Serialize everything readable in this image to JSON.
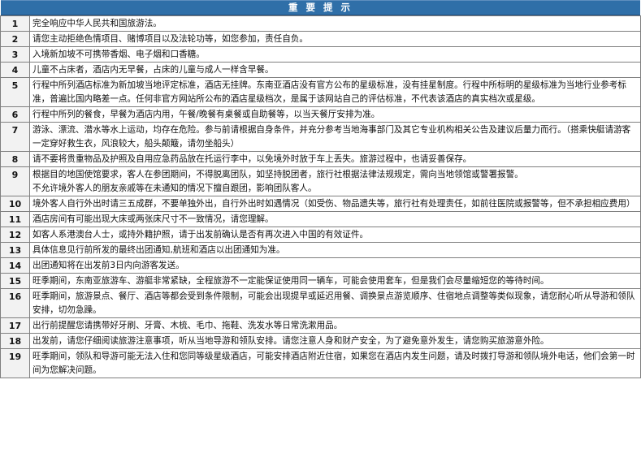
{
  "title": "重 要 提 示",
  "rows": [
    {
      "num": "1",
      "text": "完全响应中华人民共和国旅游法。"
    },
    {
      "num": "2",
      "text": "请您主动拒绝色情项目、赌博项目以及法轮功等，如您参加，责任自负。"
    },
    {
      "num": "3",
      "text": "入境新加坡不可携带香烟、电子烟和口香糖。"
    },
    {
      "num": "4",
      "text": "儿童不占床者，酒店内无早餐，占床的儿童与成人一样含早餐。"
    },
    {
      "num": "5",
      "text": "行程中所列酒店标准为新加坡当地评定标准，酒店无挂牌。东南亚酒店没有官方公布的星级标准，没有挂星制度。行程中所标明的星级标准为当地行业参考标准，普遍比国内略差一点。任何非官方网站所公布的酒店星级档次，是属于该网站自己的评估标准，不代表该酒店的真实档次或星级。"
    },
    {
      "num": "6",
      "text": "行程中所列的餐食，早餐为酒店内用，午餐/晚餐有桌餐或自助餐等，以当天餐厅安排为准。"
    },
    {
      "num": "7",
      "text": "游泳、漂流、潜水等水上运动，均存在危险。参与前请根据自身条件，并充分参考当地海事部门及其它专业机构相关公告及建议后量力而行。（搭乘快艇请游客一定穿好救生衣，风浪较大，船头颠簸，请勿坐船头）"
    },
    {
      "num": "8",
      "text": "请不要将贵重物品及护照及自用应急药品放在托运行李中，以免境外时放于车上丢失。旅游过程中，也请妥善保存。"
    },
    {
      "num": "9",
      "text": "根据目的地国使馆要求，客人在参团期间，不得脱离团队，如坚持脱团者，旅行社根据法律法规规定，需向当地领馆或警署报警。\n不允许境外客人的朋友亲戚等在未通知的情况下擅自跟团，影响团队客人。"
    },
    {
      "num": "10",
      "text": "境外客人自行外出时请三五成群，不要单独外出，自行外出时如遇情况（如受伤、物品遗失等，旅行社有处理责任，如前往医院或报警等，但不承担相应费用）"
    },
    {
      "num": "11",
      "text": "酒店房间有可能出现大床或两张床尺寸不一致情况，请您理解。"
    },
    {
      "num": "12",
      "text": "如客人系港澳台人士，或持外籍护照，请于出发前确认是否有再次进入中国的有效证件。"
    },
    {
      "num": "13",
      "text": "具体信息见行前所发的最终出团通知,航班和酒店以出团通知为准。"
    },
    {
      "num": "14",
      "text": "出团通知将在出发前3日内向游客发送。"
    },
    {
      "num": "15",
      "text": "旺季期间，东南亚旅游车、游艇非常紧缺，全程旅游不一定能保证使用同一辆车，可能会使用套车，但是我们会尽量缩短您的等待时间。"
    },
    {
      "num": "16",
      "text": "旺季期间，旅游景点、餐厅、酒店等都会受到条件限制，可能会出现提早或延迟用餐、调换景点游览顺序、住宿地点调整等类似现象，请您耐心听从导游和领队安排，切勿急躁。"
    },
    {
      "num": "17",
      "text": "出行前提醒您请携带好牙刷、牙膏、木梳、毛巾、拖鞋、洗发水等日常洗漱用品。"
    },
    {
      "num": "18",
      "text": "出发前，请您仔细阅读旅游注意事项，听从当地导游和领队安排。请您注意人身和财产安全，为了避免意外发生，请您购买旅游意外险。"
    },
    {
      "num": "19",
      "text": "旺季期间，领队和导游可能无法入住和您同等级星级酒店，可能安排酒店附近住宿，如果您在酒店内发生问题，请及时拨打导游和领队境外电话，他们会第一时间为您解决问题。"
    }
  ]
}
